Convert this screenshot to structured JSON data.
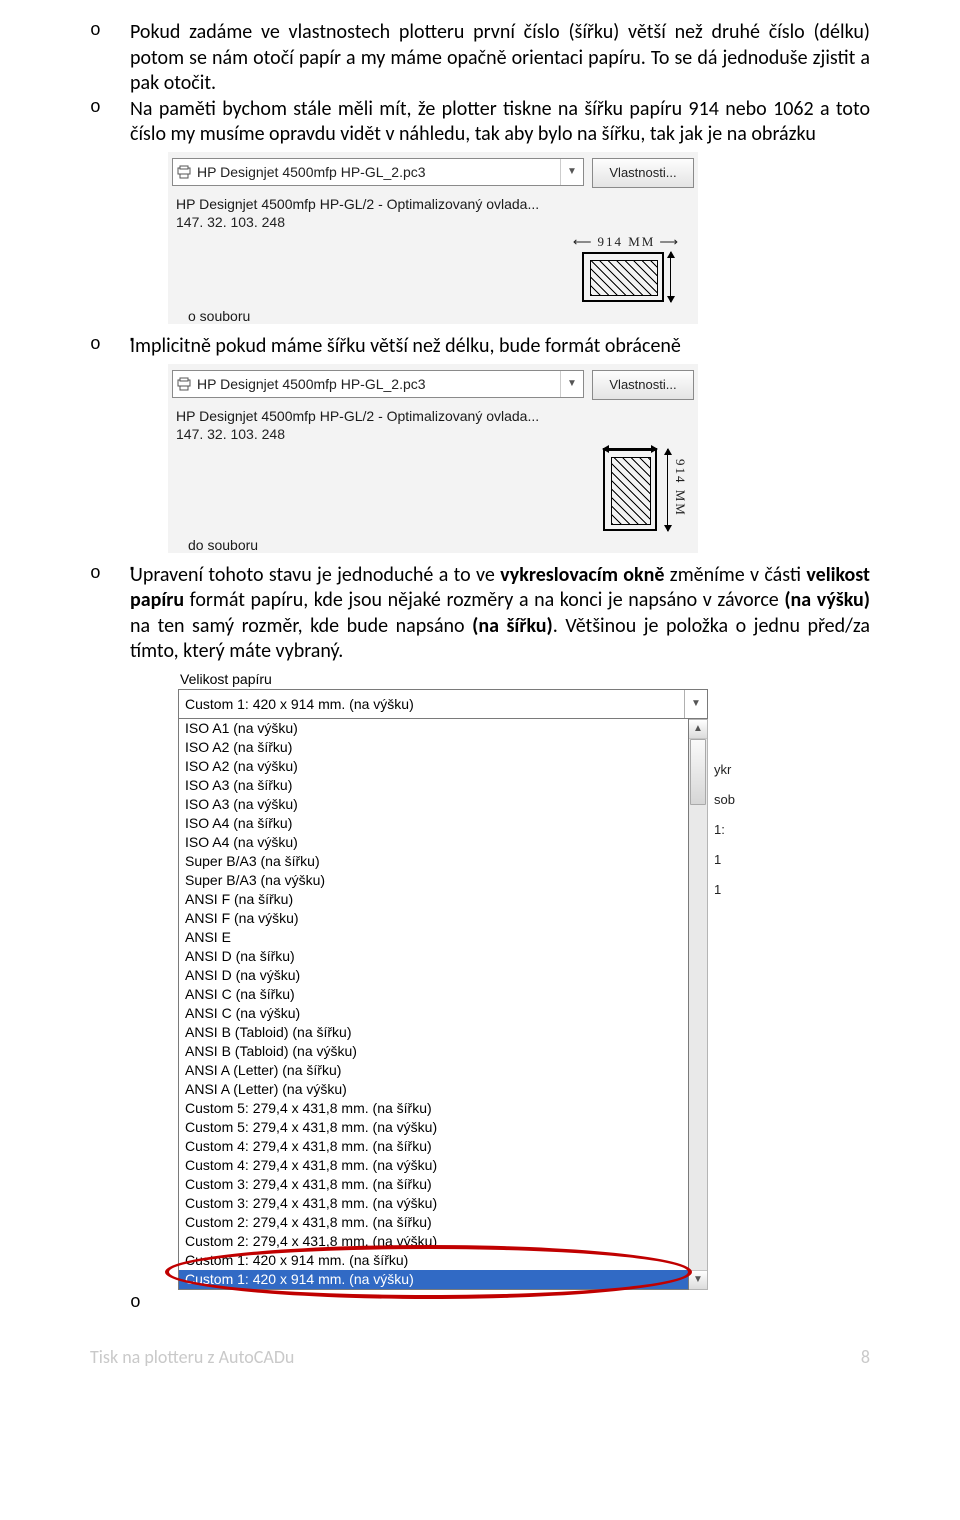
{
  "bullets": {
    "b1": "Pokud zadáme ve vlastnostech plotteru první číslo (šířku) větší než druhé číslo (délku) potom se nám otočí papír a my máme opačně orientaci papíru. To se dá jednoduše zjistit a pak otočit.",
    "b2": "Na paměti bychom stále měli mít, že plotter tiskne na šířku papíru 914 nebo 1062 a toto číslo my musíme opravdu vidět v náhledu, tak aby bylo na šířku, tak jak je na obrázku",
    "b3": "Implicitně pokud máme šířku větší než délku, bude formát obráceně",
    "b4_pre": "Upravení tohoto stavu je jednoduché a to ve ",
    "b4_bold1": "vykreslovacím okně",
    "b4_mid1": " změníme v části ",
    "b4_bold2": "velikost papíru",
    "b4_mid2": " formát papíru, kde jsou nějaké rozměry a na konci je napsáno v závorce ",
    "b4_bold3": "(na výšku)",
    "b4_mid3": " na ten samý rozměr, kde bude napsáno ",
    "b4_bold4": "(na šířku)",
    "b4_tail": ". Většinou je položka o jednu před/za tímto, který máte vybraný."
  },
  "panel1": {
    "plotter": "HP Designjet 4500mfp HP-GL_2.pc3",
    "vlastnosti": "Vlastnosti...",
    "driver": "HP Designjet 4500mfp HP-GL/2 - Optimalizovaný ovlada...",
    "ip": "147. 32. 103. 248",
    "dim": "914  MM",
    "frag": "o souboru"
  },
  "panel2": {
    "plotter": "HP Designjet 4500mfp HP-GL_2.pc3",
    "vlastnosti": "Vlastnosti...",
    "driver": "HP Designjet 4500mfp HP-GL/2 - Optimalizovaný ovlada...",
    "ip": "147. 32. 103. 248",
    "dim": "914  MM",
    "frag": "do souboru"
  },
  "paperSize": {
    "groupLabel": "Velikost papíru",
    "selected": "Custom 1: 420  x  914 mm. (na výšku)",
    "items": [
      "ISO A1 (na výšku)",
      "ISO A2 (na šířku)",
      "ISO A2 (na výšku)",
      "ISO A3 (na šířku)",
      "ISO A3 (na výšku)",
      "ISO A4 (na šířku)",
      "ISO A4 (na výšku)",
      "Super B/A3 (na šířku)",
      "Super B/A3 (na výšku)",
      "ANSI F (na šířku)",
      "ANSI F (na výšku)",
      "ANSI E",
      "ANSI D (na šířku)",
      "ANSI D (na výšku)",
      "ANSI C (na šířku)",
      "ANSI C (na výšku)",
      "ANSI B (Tabloid) (na šířku)",
      "ANSI B (Tabloid) (na výšku)",
      "ANSI A (Letter) (na šířku)",
      "ANSI A (Letter) (na výšku)",
      "Custom 5: 279,4  x  431,8 mm. (na šířku)",
      "Custom 5: 279,4  x  431,8 mm. (na výšku)",
      "Custom 4: 279,4  x  431,8 mm. (na šířku)",
      "Custom 4: 279,4  x  431,8 mm. (na výšku)",
      "Custom 3: 279,4  x  431,8 mm. (na šířku)",
      "Custom 3: 279,4  x  431,8 mm. (na výšku)",
      "Custom 2: 279,4  x  431,8 mm. (na šířku)",
      "Custom 2: 279,4  x  431,8 mm. (na výšku)",
      "Custom 1: 420  x  914 mm. (na šířku)",
      "Custom 1: 420  x  914 mm. (na výšku)"
    ],
    "highlightIndex": 29,
    "side": [
      "ykr",
      "sob",
      "1:",
      "1",
      "1"
    ]
  },
  "footer": {
    "title": "Tisk na plotteru z AutoCADu",
    "page": "8"
  }
}
